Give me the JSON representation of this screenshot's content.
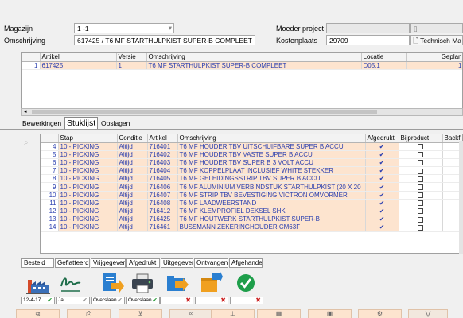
{
  "header": {
    "magazijn_label": "Magazijn",
    "magazijn_value": "1   -1",
    "omschrijving_label": "Omschrijving",
    "omschrijving_value": "617425 / T6 MF STARTHULPKIST SUPER-B COMPLEET",
    "moeder_label": "Moeder project",
    "moeder_value": "",
    "kostenplaats_label": "Kostenplaats",
    "kostenplaats_value": "29709",
    "technisch_label": "Technisch Ma"
  },
  "top_grid": {
    "columns": [
      "Artikel",
      "Versie",
      "Omschrijving",
      "Locatie",
      "Geplan"
    ],
    "rows": [
      {
        "num": "1",
        "artikel": "617425",
        "versie": "1",
        "omschrijving": "T6 MF STARTHULPKIST SUPER-B COMPLEET",
        "locatie": "D05.1",
        "gepland": "1"
      }
    ]
  },
  "tabs": [
    {
      "label": "Bewerkingen",
      "active": false
    },
    {
      "label": "Stuklijst",
      "active": true
    },
    {
      "label": "Opslagen",
      "active": false
    }
  ],
  "bom_grid": {
    "columns": [
      "Stap",
      "Conditie",
      "Artikel",
      "Omschrijving",
      "Afgedrukt",
      "Bijproduct",
      "Backfl"
    ],
    "rows": [
      {
        "num": "4",
        "stap": "10 - PICKING",
        "conditie": "Altijd",
        "artikel": "716401",
        "omschrijving": "T6 MF HOUDER TBV UITSCHUIFBARE SUPER B ACCU",
        "afgedrukt": "✔"
      },
      {
        "num": "5",
        "stap": "10 - PICKING",
        "conditie": "Altijd",
        "artikel": "716402",
        "omschrijving": "T6 MF HOUDER TBV VASTE SUPER B ACCU",
        "afgedrukt": "✔"
      },
      {
        "num": "6",
        "stap": "10 - PICKING",
        "conditie": "Altijd",
        "artikel": "716403",
        "omschrijving": "T6 MF HOUDER TBV SUPER B 3 VOLT ACCU",
        "afgedrukt": "✔"
      },
      {
        "num": "7",
        "stap": "10 - PICKING",
        "conditie": "Altijd",
        "artikel": "716404",
        "omschrijving": "T6 MF KOPPELPLAAT INCLUSIEF WHITE STEKKER",
        "afgedrukt": "✔"
      },
      {
        "num": "8",
        "stap": "10 - PICKING",
        "conditie": "Altijd",
        "artikel": "716405",
        "omschrijving": "T6 MF GELEIDINGSSTRIP TBV SUPER B ACCU",
        "afgedrukt": "✔"
      },
      {
        "num": "9",
        "stap": "10 - PICKING",
        "conditie": "Altijd",
        "artikel": "716406",
        "omschrijving": "T6 MF ALUMINIUM VERBINDSTUK STARTHULPKIST (20 X 20",
        "afgedrukt": "✔"
      },
      {
        "num": "10",
        "stap": "10 - PICKING",
        "conditie": "Altijd",
        "artikel": "716407",
        "omschrijving": "T6 MF STRIP TBV BEVESTIGING VICTRON OMVORMER",
        "afgedrukt": "✔"
      },
      {
        "num": "11",
        "stap": "10 - PICKING",
        "conditie": "Altijd",
        "artikel": "716408",
        "omschrijving": "T6 MF LAADWEERSTAND",
        "afgedrukt": "✔"
      },
      {
        "num": "12",
        "stap": "10 - PICKING",
        "conditie": "Altijd",
        "artikel": "716412",
        "omschrijving": "T6 MF KLEMPROFIEL DEKSEL SHK",
        "afgedrukt": "✔"
      },
      {
        "num": "13",
        "stap": "10 - PICKING",
        "conditie": "Altijd",
        "artikel": "716425",
        "omschrijving": "T6 MF HOUTWERK STARTHULPKIST SUPER-B",
        "afgedrukt": "✔"
      },
      {
        "num": "14",
        "stap": "10 - PICKING",
        "conditie": "Altijd",
        "artikel": "716461",
        "omschrijving": "BUSSMANN ZEKERINGHOUDER CM63F",
        "afgedrukt": "✔"
      }
    ]
  },
  "status_labels": [
    "Besteld",
    "Gefiatteerd",
    "Vrijgegeven",
    "Afgedrukt",
    "Uitgegeven",
    "Ontvangen",
    "Afgehandeld"
  ],
  "action_icons": [
    "factory-icon",
    "signature-icon",
    "document-export-icon",
    "printer-icon",
    "folder-export-icon",
    "box-export-icon",
    "confirm-check-icon"
  ],
  "mini_fields": [
    {
      "text": "12-4-17",
      "mark": "✔",
      "mark_color": "#2e9e3e"
    },
    {
      "text": "Ja",
      "mark": "✔",
      "mark_color": "#999999"
    },
    {
      "text": "Overslaan",
      "mark": "✔",
      "mark_color": "#999999"
    },
    {
      "text": "Overslaan",
      "mark": "✔",
      "mark_color": "#2e9e3e"
    },
    {
      "text": "",
      "mark": "✖",
      "mark_color": "#cc2222"
    },
    {
      "text": "",
      "mark": "✖",
      "mark_color": "#cc2222"
    },
    {
      "text": "",
      "mark": "✖",
      "mark_color": "#cc2222"
    }
  ],
  "colors": {
    "row_bg": "#fde4cf",
    "link_text": "#2a3fb0"
  }
}
